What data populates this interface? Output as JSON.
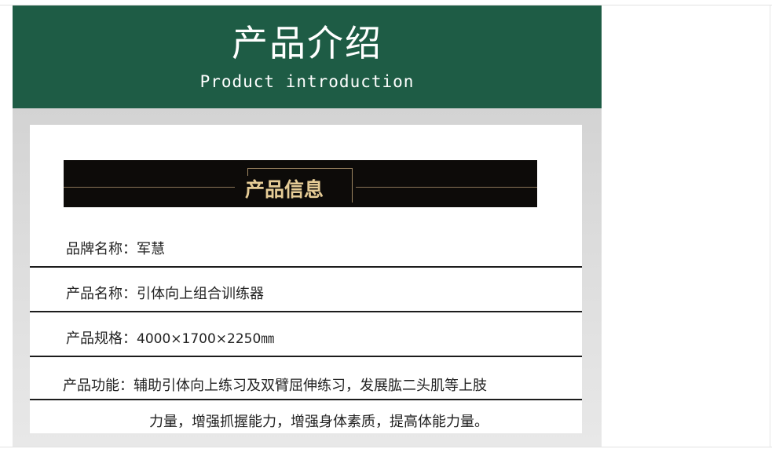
{
  "header": {
    "title_cn": "产品介绍",
    "title_en": "Product introduction"
  },
  "banner": {
    "title": "产品信息"
  },
  "info": {
    "brand_label": "品牌名称：",
    "brand_value": "军慧",
    "name_label": "产品名称：",
    "name_value": "引体向上组合训练器",
    "spec_label": "产品规格：",
    "spec_value": "4000×1700×2250㎜",
    "function_label": "产品功能：",
    "function_value_line1": "辅助引体向上练习及双臂屈伸练习，发展肱二头肌等上肢",
    "function_value_line2": "力量，增强抓握能力，增强身体素质，提高体能力量。"
  },
  "colors": {
    "header_bg": "#1e5c45",
    "banner_bg": "#0d0b09",
    "banner_text": "#e6cc96"
  }
}
